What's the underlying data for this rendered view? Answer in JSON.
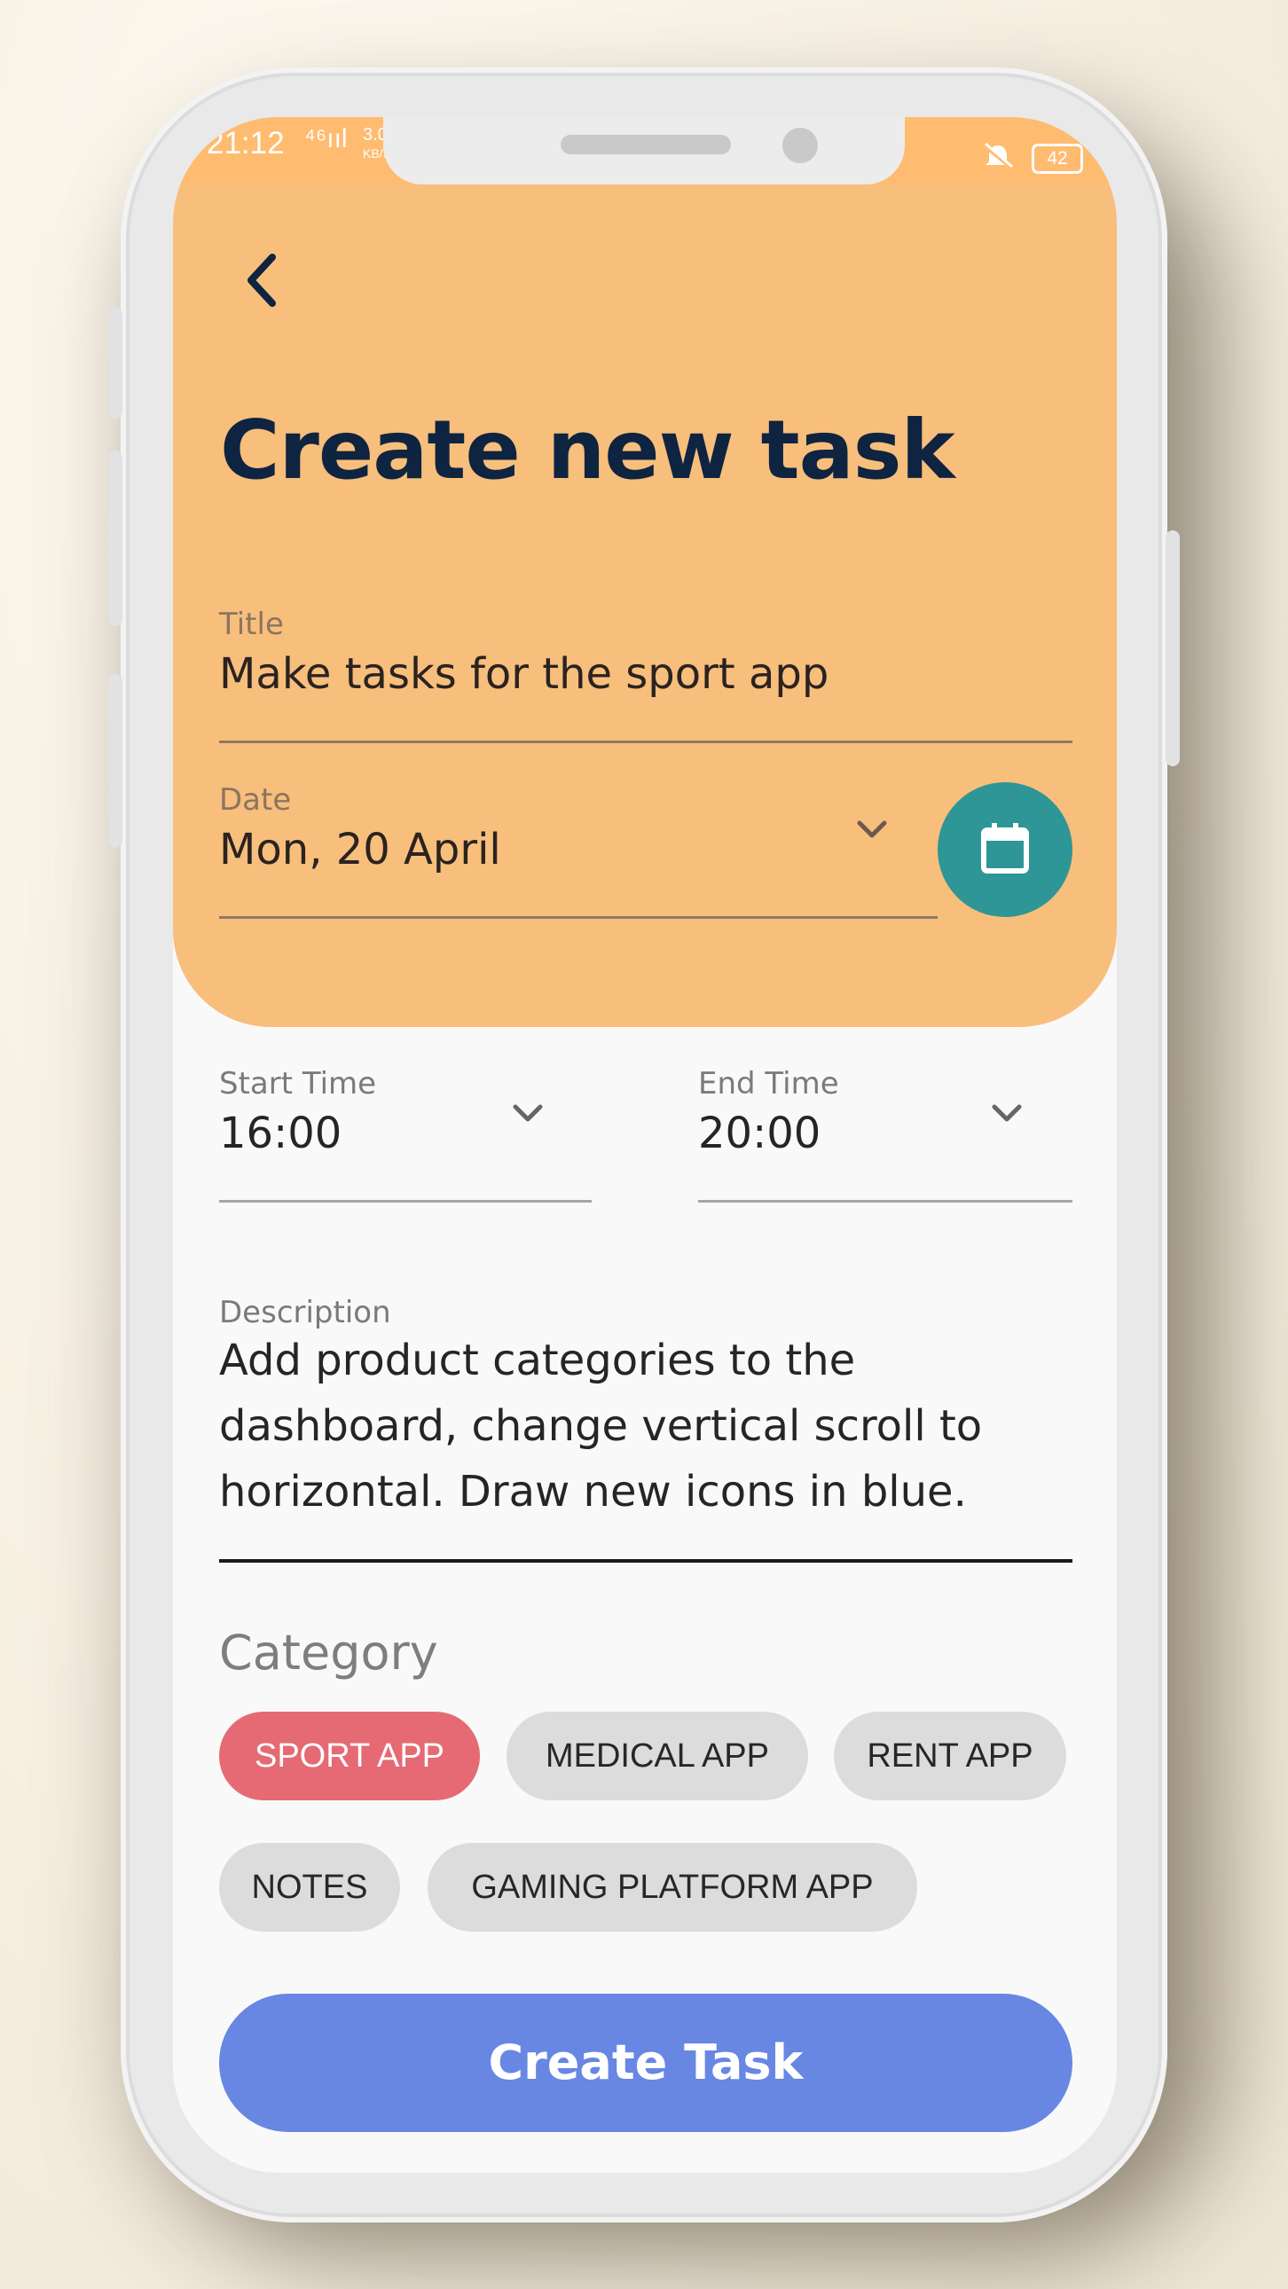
{
  "status_bar": {
    "time": "21:12",
    "signal": "⁴⁶ııl",
    "speed": "3.0",
    "speed_unit": "KB/S",
    "battery": "42"
  },
  "header": {
    "title": "Create new task",
    "back_icon": "chevron-left-icon",
    "background_color": "#f8be7c"
  },
  "form": {
    "title_field": {
      "label": "Title",
      "value": "Make tasks for the sport app"
    },
    "date_field": {
      "label": "Date",
      "value": "Mon, 20 April",
      "icon": "chevron-down-icon"
    },
    "calendar_button": {
      "icon": "calendar-icon",
      "color": "#2e9696"
    },
    "start_time": {
      "label": "Start Time",
      "value": "16:00"
    },
    "end_time": {
      "label": "End Time",
      "value": "20:00"
    },
    "description": {
      "label": "Description",
      "value": "Add product categories to the dashboard, change vertical scroll to horizontal. Draw new icons in blue."
    }
  },
  "category": {
    "title": "Category",
    "chips": [
      {
        "label": "SPORT APP",
        "selected": true
      },
      {
        "label": "MEDICAL APP",
        "selected": false
      },
      {
        "label": "RENT APP",
        "selected": false
      },
      {
        "label": "NOTES",
        "selected": false
      },
      {
        "label": "GAMING PLATFORM APP",
        "selected": false
      }
    ],
    "selected_color": "#e56a74"
  },
  "actions": {
    "create_label": "Create Task",
    "create_color": "#6887e3"
  }
}
